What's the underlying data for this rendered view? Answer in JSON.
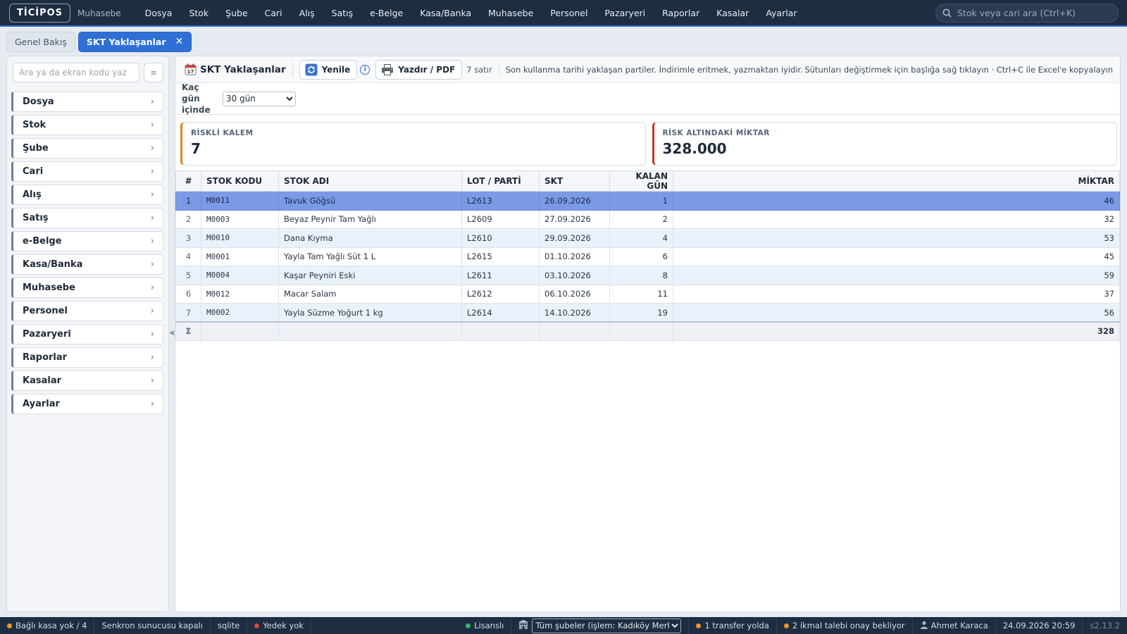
{
  "topbar": {
    "logo": "TİCİPOS",
    "module": "Muhasebe",
    "menu": [
      "Dosya",
      "Stok",
      "Şube",
      "Cari",
      "Alış",
      "Satış",
      "e-Belge",
      "Kasa/Banka",
      "Muhasebe",
      "Personel",
      "Pazaryeri",
      "Raporlar",
      "Kasalar",
      "Ayarlar"
    ],
    "search_placeholder": "Stok veya cari ara (Ctrl+K)"
  },
  "tabs": [
    {
      "label": "Genel Bakış",
      "active": false
    },
    {
      "label": "SKT Yaklaşanlar",
      "active": true
    }
  ],
  "sidebar": {
    "search_placeholder": "Ara ya da ekran kodu yaz",
    "items": [
      "Dosya",
      "Stok",
      "Şube",
      "Cari",
      "Alış",
      "Satış",
      "e-Belge",
      "Kasa/Banka",
      "Muhasebe",
      "Personel",
      "Pazaryeri",
      "Raporlar",
      "Kasalar",
      "Ayarlar"
    ]
  },
  "toolbar": {
    "title": "SKT Yaklaşanlar",
    "refresh_label": "Yenile",
    "print_label": "Yazdır / PDF",
    "row_count": "7 satır",
    "description": "Son kullanma tarihi yaklaşan partiler. İndirimle eritmek, yazmaktan iyidir.",
    "hint": "Sütunları değiştirmek için başlığa sağ tıklayın · Ctrl+C ile Excel'e kopyalayın"
  },
  "filter": {
    "label": "Kaç gün içinde",
    "selected": "30 gün"
  },
  "cards": [
    {
      "title": "RİSKLİ KALEM",
      "value": "7",
      "accent": "#d88a1c"
    },
    {
      "title": "RİSK ALTINDAKİ MİKTAR",
      "value": "328.000",
      "accent": "#c2352b"
    }
  ],
  "table": {
    "columns": [
      "#",
      "STOK KODU",
      "STOK ADI",
      "LOT / PARTİ",
      "SKT",
      "KALAN GÜN",
      "MİKTAR"
    ],
    "rows": [
      {
        "no": "1",
        "code": "M0011",
        "name": "Tavuk Göğsü",
        "lot": "L2613",
        "skt": "26.09.2026",
        "days": "1",
        "qty": "46"
      },
      {
        "no": "2",
        "code": "M0003",
        "name": "Beyaz Peynir Tam Yağlı",
        "lot": "L2609",
        "skt": "27.09.2026",
        "days": "2",
        "qty": "32"
      },
      {
        "no": "3",
        "code": "M0010",
        "name": "Dana Kıyma",
        "lot": "L2610",
        "skt": "29.09.2026",
        "days": "4",
        "qty": "53"
      },
      {
        "no": "4",
        "code": "M0001",
        "name": "Yayla Tam Yağlı Süt 1 L",
        "lot": "L2615",
        "skt": "01.10.2026",
        "days": "6",
        "qty": "45"
      },
      {
        "no": "5",
        "code": "M0004",
        "name": "Kaşar Peyniri Eski",
        "lot": "L2611",
        "skt": "03.10.2026",
        "days": "8",
        "qty": "59"
      },
      {
        "no": "6",
        "code": "M0012",
        "name": "Macar Salam",
        "lot": "L2612",
        "skt": "06.10.2026",
        "days": "11",
        "qty": "37"
      },
      {
        "no": "7",
        "code": "M0002",
        "name": "Yayla Süzme Yoğurt 1 kg",
        "lot": "L2614",
        "skt": "14.10.2026",
        "days": "19",
        "qty": "56"
      }
    ],
    "selected_row": 0,
    "total_symbol": "Σ",
    "total_qty": "328"
  },
  "statusbar": {
    "kasa": "Bağlı kasa yok / 4",
    "sync": "Senkron sunucusu kapalı",
    "db": "sqlite",
    "backup": "Yedek yok",
    "license": "Lisanslı",
    "branch": "Tüm şubeler (işlem: Kadıköy Merkez)",
    "transfer": "1 transfer yolda",
    "restock": "2 ikmal talebi onay bekliyor",
    "user": "Ahmet Karaca",
    "datetime": "24.09.2026 20:59",
    "version": "s2.13.2"
  },
  "colors": {
    "accent": "#2f6fd6",
    "topbar": "#1d2d42",
    "selected_row": "#7b9ae6",
    "status_ok": "#36b36a",
    "status_warn": "#e8962a",
    "status_bad": "#d9463b"
  }
}
